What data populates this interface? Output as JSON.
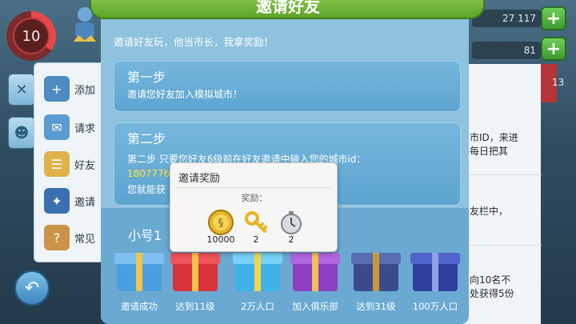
{
  "hud": {
    "level": "10",
    "resource_1": "27 117",
    "resource_2": "81",
    "side_number": "13"
  },
  "left_menu": [
    {
      "label": "添加"
    },
    {
      "label": "请求"
    },
    {
      "label": "好友"
    },
    {
      "label": "邀请"
    },
    {
      "label": "常见"
    }
  ],
  "right_panel": {
    "text_1": "市ID，来进\n每日把其",
    "text_2": "友栏中，",
    "text_3": "向10名不\n处获得5份"
  },
  "dialog": {
    "title": "邀请好友",
    "intro": "邀请好友玩，他当市长，我拿奖励！",
    "step1": {
      "title": "第一步",
      "text": "邀请您好友加入模拟城市！"
    },
    "step2": {
      "title": "第二步",
      "line1": "第二步 只要您好友6级前在好友邀请中输入您的城市id：",
      "city_id": "1807776",
      "line3": "您就能获"
    },
    "subtitle": "小号1",
    "milestones": [
      {
        "label": "邀请成功",
        "color": "#4a9fe0"
      },
      {
        "label": "达到11级",
        "color": "#d8323a"
      },
      {
        "label": "2万人口",
        "color": "#3fb3e8"
      },
      {
        "label": "加入俱乐部",
        "color": "#8c3fc0"
      },
      {
        "label": "达到31级",
        "color": "#3a4a8c"
      },
      {
        "label": "100万人口",
        "color": "#2f3f9c"
      }
    ]
  },
  "popup": {
    "title": "邀请奖励",
    "subtitle": "奖励：",
    "rewards": [
      {
        "icon": "simoleon-coin-icon",
        "value": "10000"
      },
      {
        "icon": "golden-key-icon",
        "value": "2"
      },
      {
        "icon": "speed-up-token-icon",
        "value": "2"
      }
    ]
  }
}
